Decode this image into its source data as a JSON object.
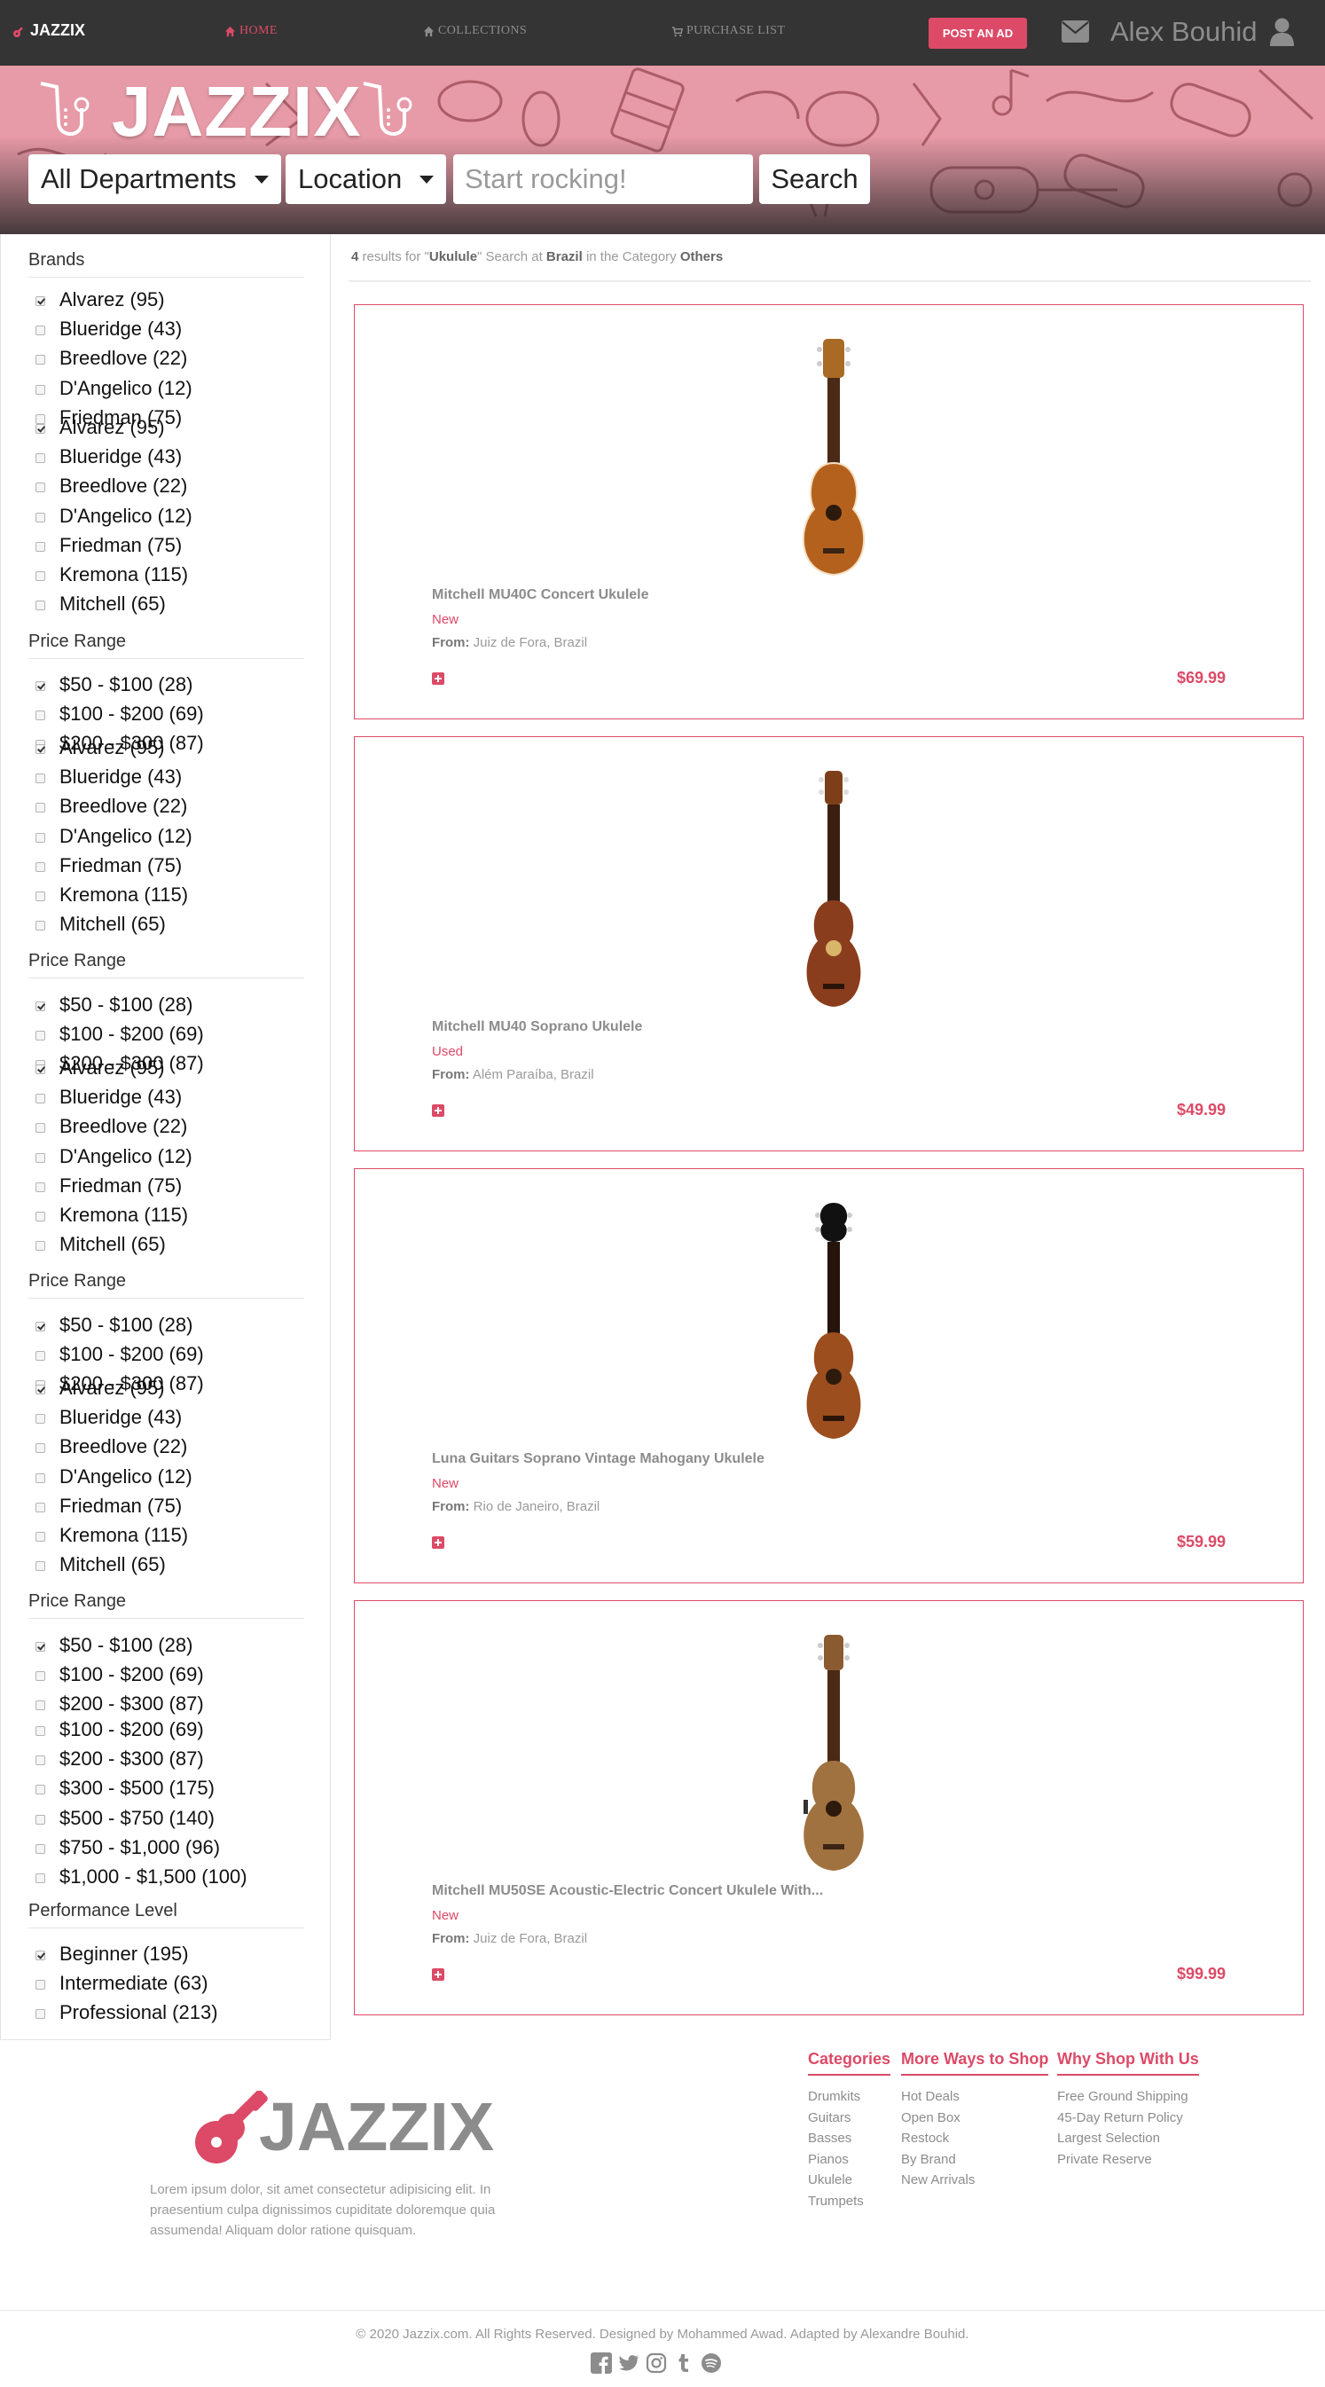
{
  "navbar": {
    "brand": "JAZZIX",
    "links": [
      {
        "label": "HOME",
        "icon": "home-icon",
        "active": true
      },
      {
        "label": "COLLECTIONS",
        "icon": "home-icon",
        "active": false
      },
      {
        "label": "PURCHASE LIST",
        "icon": "cart-icon",
        "active": false
      }
    ],
    "post_ad": "POST AN AD",
    "user_name": "Alex Bouhid",
    "accent": "#dc4a67"
  },
  "hero": {
    "logo": "JAZZIX",
    "department": "All Departments",
    "location": "Location",
    "search_placeholder": "Start rocking!",
    "search_button": "Search"
  },
  "sidebar": {
    "brands_heading": "Brands",
    "price_heading": "Price Range",
    "performance_heading": "Performance Level",
    "brands": [
      "Alvarez (95)",
      "Blueridge (43)",
      "Breedlove (22)",
      "D'Angelico (12)",
      "Friedman (75)",
      "Kremona (115)",
      "Mitchell (65)"
    ],
    "prices": [
      "$50 - $100 (28)",
      "$100 - $200 (69)",
      "$200 - $300 (87)",
      "$300 - $500 (175)",
      "$500 - $750 (140)",
      "$750 - $1,000 (96)",
      "$1,000 - $1,500 (100)"
    ],
    "levels": [
      "Beginner (195)",
      "Intermediate (63)",
      "Professional (213)"
    ]
  },
  "results": {
    "count": "4",
    "t1": " results for \"",
    "query": "Ukulule",
    "t2": "\" Search at ",
    "place": "Brazil",
    "t3": " in the Category ",
    "category": "Others"
  },
  "products": [
    {
      "title": "Mitchell MU40C Concert Ukulele",
      "condition": "New",
      "from_label": "From:",
      "from": "Juiz de Fora, Brazil",
      "price": "$69.99"
    },
    {
      "title": "Mitchell MU40 Soprano Ukulele",
      "condition": "Used",
      "from_label": "From:",
      "from": "Além Paraíba, Brazil",
      "price": "$49.99"
    },
    {
      "title": "Luna Guitars Soprano Vintage Mahogany Ukulele",
      "condition": "New",
      "from_label": "From:",
      "from": "Rio de Janeiro, Brazil",
      "price": "$59.99"
    },
    {
      "title": "Mitchell MU50SE Acoustic-Electric Concert Ukulele With...",
      "condition": "New",
      "from_label": "From:",
      "from": "Juiz de Fora, Brazil",
      "price": "$99.99"
    }
  ],
  "footer": {
    "logo": "JAZZIX",
    "lorem": "Lorem ipsum dolor, sit amet consectetur adipisicing elit. In praesentium culpa dignissimos cupiditate doloremque quia assumenda! Aliquam dolor ratione quisquam.",
    "columns": [
      {
        "title": "Categories",
        "items": [
          "Drumkits",
          "Guitars",
          "Basses",
          "Pianos",
          "Ukulele",
          "Trumpets"
        ]
      },
      {
        "title": "More Ways to Shop",
        "items": [
          "Hot Deals",
          "Open Box",
          "Restock",
          "By Brand",
          "New Arrivals"
        ]
      },
      {
        "title": "Why Shop With Us",
        "items": [
          "Free Ground Shipping",
          "45-Day Return Policy",
          "Largest Selection",
          "Private Reserve"
        ]
      }
    ],
    "copyright": "© 2020 Jazzix.com. All Rights Reserved. Designed by Mohammed Awad. Adapted by Alexandre Bouhid.",
    "socials": [
      "facebook-icon",
      "twitter-icon",
      "instagram-icon",
      "tumblr-icon",
      "spotify-icon"
    ]
  }
}
